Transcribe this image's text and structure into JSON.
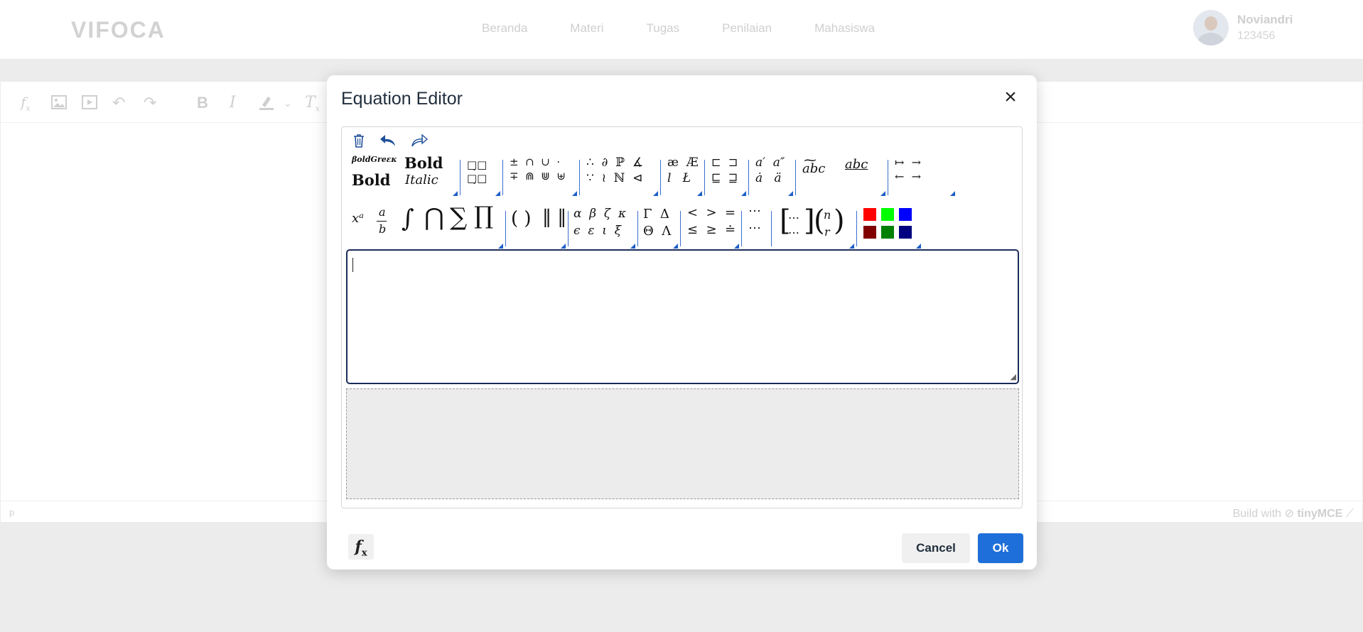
{
  "app": {
    "logo": "VIFOCA",
    "nav": [
      "Beranda",
      "Materi",
      "Tugas",
      "Penilaian",
      "Mahasiswa"
    ],
    "user": {
      "name": "Noviandri",
      "id": "123456"
    }
  },
  "editor": {
    "toolbar_icons": [
      "fx-icon",
      "image-icon",
      "media-icon",
      "undo-icon",
      "redo-icon",
      "bold-icon",
      "italic-icon",
      "highlight-icon",
      "chevron-down-icon",
      "clear-format-icon"
    ],
    "status_path": "p",
    "branding_prefix": "Build with",
    "branding_name": "tinyMCE"
  },
  "dialog": {
    "title": "Equation Editor",
    "close_glyph": "×",
    "actions": {
      "trash": "🗑",
      "undo": "↶",
      "redo": "↷"
    },
    "palette_row1": {
      "style_small": "βoldGreεκ",
      "style_bold_roman": "Bold",
      "style_bold_serif": "Bold",
      "style_italic": "Italic",
      "boxes": "□̣□\n□̣□",
      "ops1": "±  ∩  ∪  ·",
      "ops2": "∓  ⋒  ⋓  ⊎",
      "rel1": "∴  ∂  ℙ  ∡",
      "rel2": "∵  ≀  ℕ  ⊲",
      "letters1": "æ  Æ",
      "letters2": "l   Ł",
      "sets1": "⊏  ⊐",
      "sets2": "⊑  ⊒",
      "accents1": "a′  a″",
      "accents2": "ȧ   ä",
      "wide_tilde": "abc",
      "underline": "abc",
      "arrows1": "↦  →",
      "arrows2": "←  →"
    },
    "palette_row2": {
      "sup": "xᵃ",
      "frac_num": "a",
      "frac_den": "b",
      "integral": "∫",
      "bigcap": "⋂",
      "sum": "∑",
      "prod": "∏",
      "parens": "( )",
      "norms": "‖ ‖",
      "greek1": "α  β  ζ  κ",
      "greek2": "ϵ  ε  ι  ξ",
      "capgreek1": "Γ  Δ",
      "capgreek2": "Θ  Λ",
      "ineq1": "<  >  =",
      "ineq2": "≤  ≥  ≐",
      "dots1": "⋯",
      "dots2": "⋯",
      "matrix": "⋯\n⋯",
      "binom_top": "n",
      "binom_bot": "r"
    },
    "colors": [
      "#ff0000",
      "#00ff00",
      "#0000ff",
      "#800000",
      "#008000",
      "#000080"
    ],
    "input_value": "",
    "fx_label": "f",
    "fx_sub": "x",
    "cancel_label": "Cancel",
    "ok_label": "Ok"
  }
}
